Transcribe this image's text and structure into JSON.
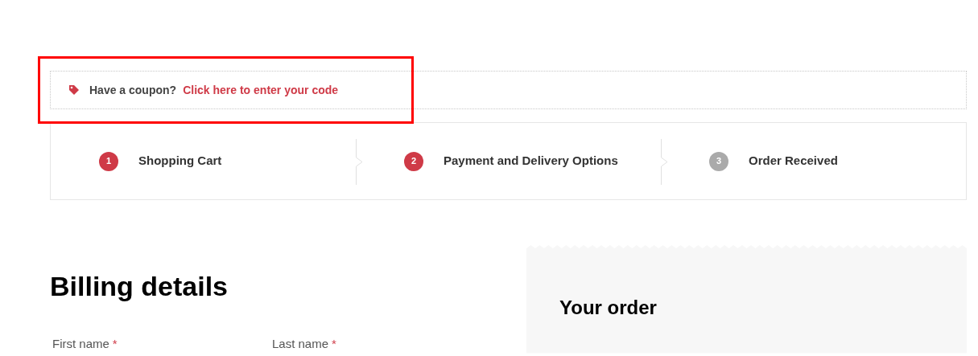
{
  "coupon": {
    "prompt": "Have a coupon?",
    "link": "Click here to enter your code"
  },
  "steps": [
    {
      "number": "1",
      "label": "Shopping Cart",
      "active": true
    },
    {
      "number": "2",
      "label": "Payment and Delivery Options",
      "active": true
    },
    {
      "number": "3",
      "label": "Order Received",
      "active": false
    }
  ],
  "billing": {
    "title": "Billing details",
    "fields": [
      {
        "label": "First name",
        "required_mark": "*"
      },
      {
        "label": "Last name",
        "required_mark": "*"
      }
    ]
  },
  "order": {
    "title": "Your order"
  }
}
